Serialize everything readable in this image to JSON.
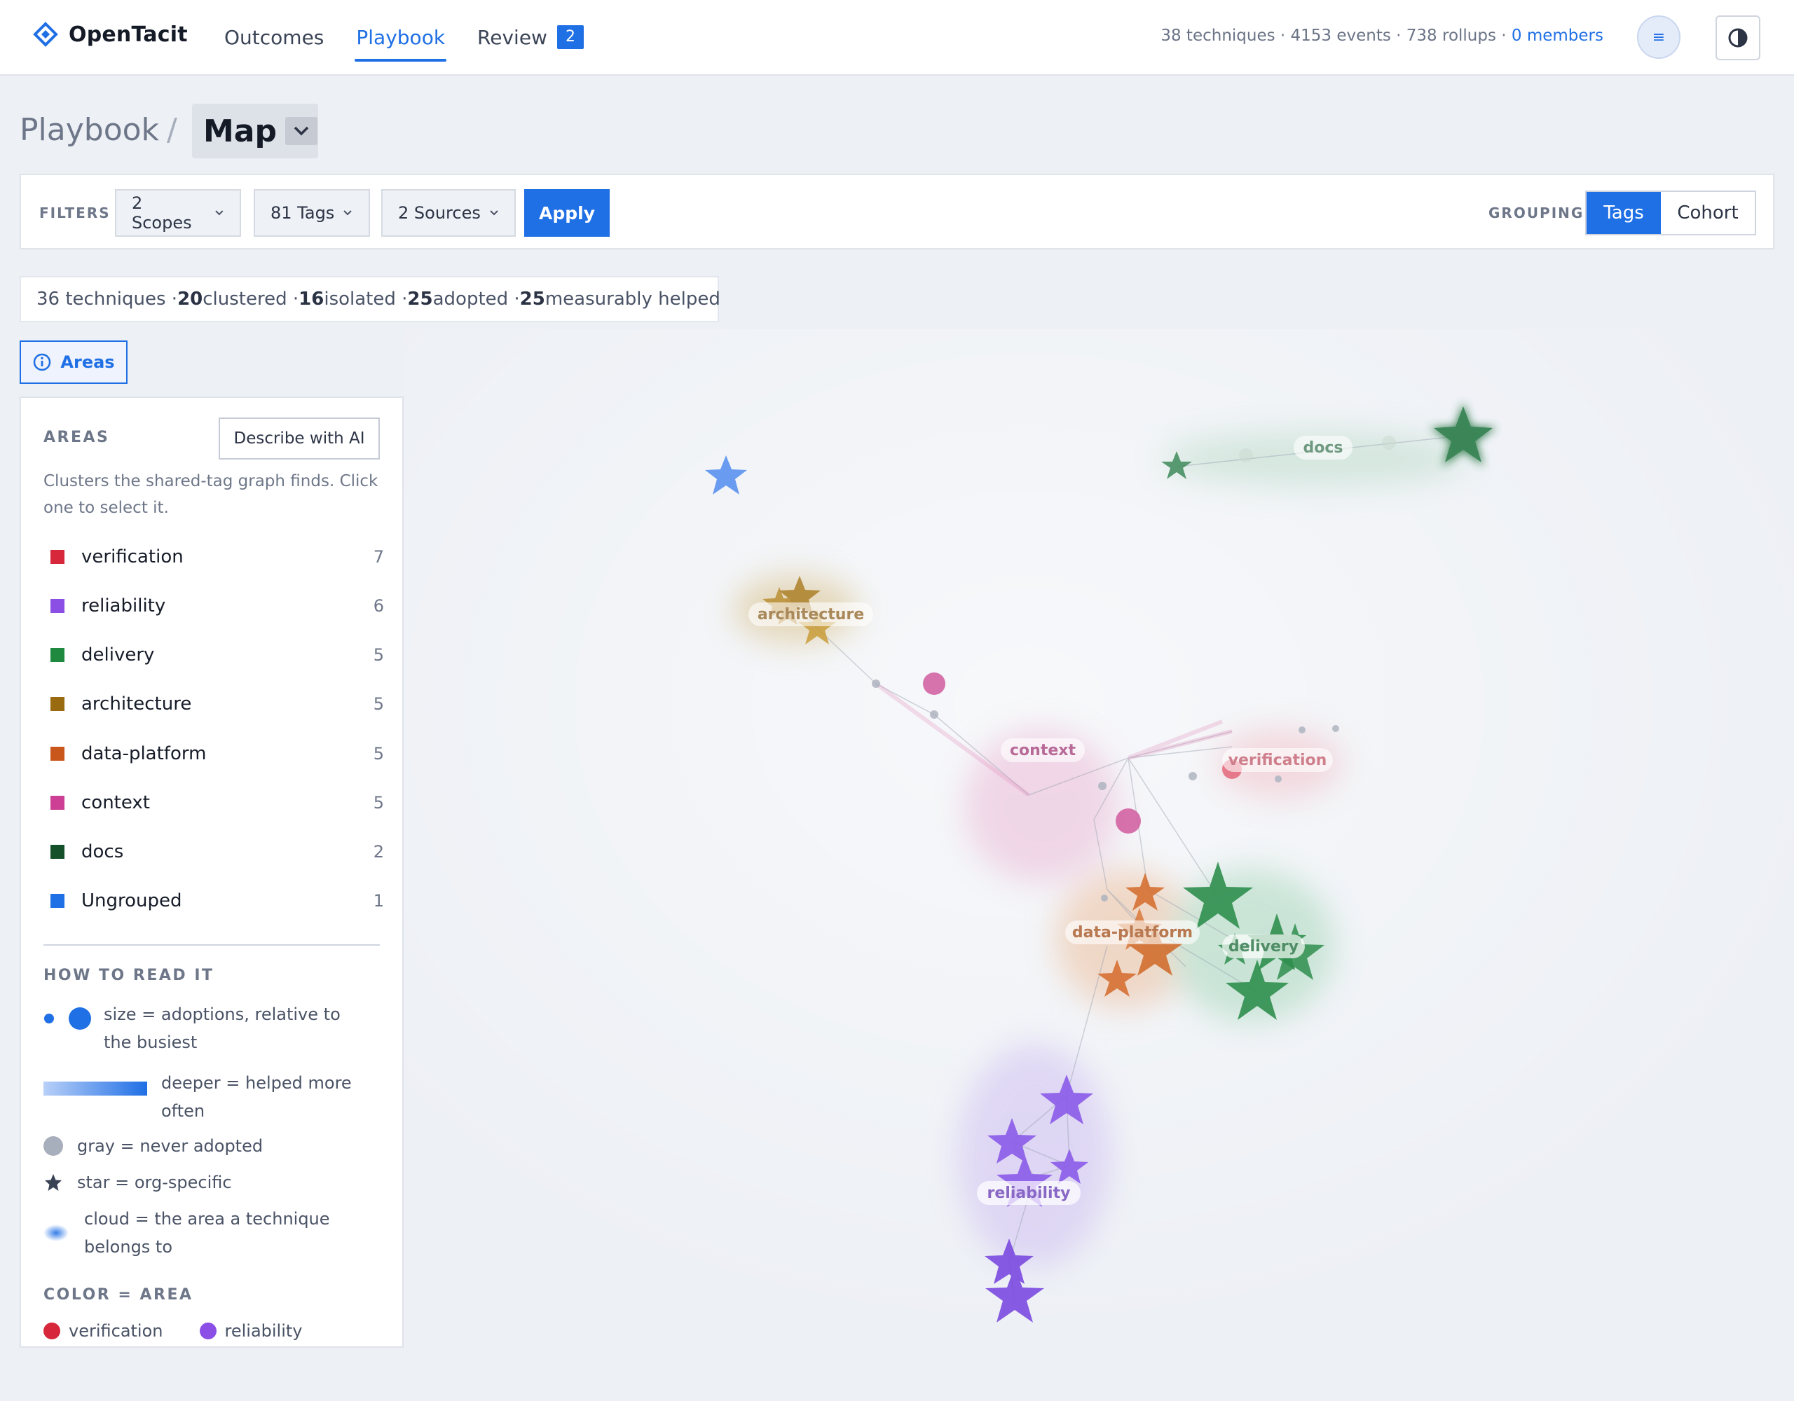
{
  "app": {
    "name": "OpenTacit",
    "nav": [
      {
        "label": "Outcomes",
        "active": false
      },
      {
        "label": "Playbook",
        "active": true
      },
      {
        "label": "Review",
        "active": false,
        "badge": "2"
      }
    ],
    "stats": "38 techniques · 4153 events · 738 rollups · ",
    "stats_link": "0 members",
    "menu_icon": "≡",
    "accent": "#1f6fe5"
  },
  "page": {
    "breadcrumb_root": "Playbook",
    "separator": "/",
    "view": "Map"
  },
  "filters": {
    "label": "FILTERS",
    "scopes": "2 Scopes",
    "tags": "81 Tags",
    "sources": "2 Sources",
    "apply": "Apply",
    "grouping_label": "GROUPING",
    "grouping_options": [
      "Tags",
      "Cohort"
    ],
    "grouping_selected": "Tags"
  },
  "summary": {
    "techniques_text": "36 techniques · ",
    "clustered": "20",
    "clustered_text": " clustered · ",
    "isolated": "16",
    "isolated_text": " isolated · ",
    "adopted": "25",
    "adopted_text": " adopted · ",
    "helped": "25",
    "helped_text": " measurably helped"
  },
  "areas_toggle": "Areas",
  "panel": {
    "title": "AREAS",
    "describe": "Describe with AI",
    "description": "Clusters the shared-tag graph finds. Click one to select it.",
    "areas": [
      {
        "name": "verification",
        "count": "7",
        "color": "#d6283a"
      },
      {
        "name": "reliability",
        "count": "6",
        "color": "#8b4fe6"
      },
      {
        "name": "delivery",
        "count": "5",
        "color": "#1f8a3f"
      },
      {
        "name": "architecture",
        "count": "5",
        "color": "#9a6a10"
      },
      {
        "name": "data-platform",
        "count": "5",
        "color": "#c9561a"
      },
      {
        "name": "context",
        "count": "5",
        "color": "#cc3f95"
      },
      {
        "name": "docs",
        "count": "2",
        "color": "#14502a"
      },
      {
        "name": "Ungrouped",
        "count": "1",
        "color": "#1f6fe5"
      }
    ],
    "how_title": "HOW TO READ IT",
    "legend": {
      "size": "size = adoptions, relative to the busiest",
      "deeper": "deeper = helped more often",
      "gray": "gray = never adopted",
      "star": "star = org-specific",
      "cloud": "cloud = the area a technique belongs to"
    },
    "color_title": "COLOR = AREA",
    "color_items": [
      {
        "name": "verification",
        "color": "#d6283a"
      },
      {
        "name": "reliability",
        "color": "#8b4fe6"
      }
    ]
  },
  "map": {
    "cluster_labels": {
      "docs": "docs",
      "architecture": "architecture",
      "context": "context",
      "verification": "verification",
      "data_platform": "data-platform",
      "delivery": "delivery",
      "reliability": "reliability"
    }
  }
}
